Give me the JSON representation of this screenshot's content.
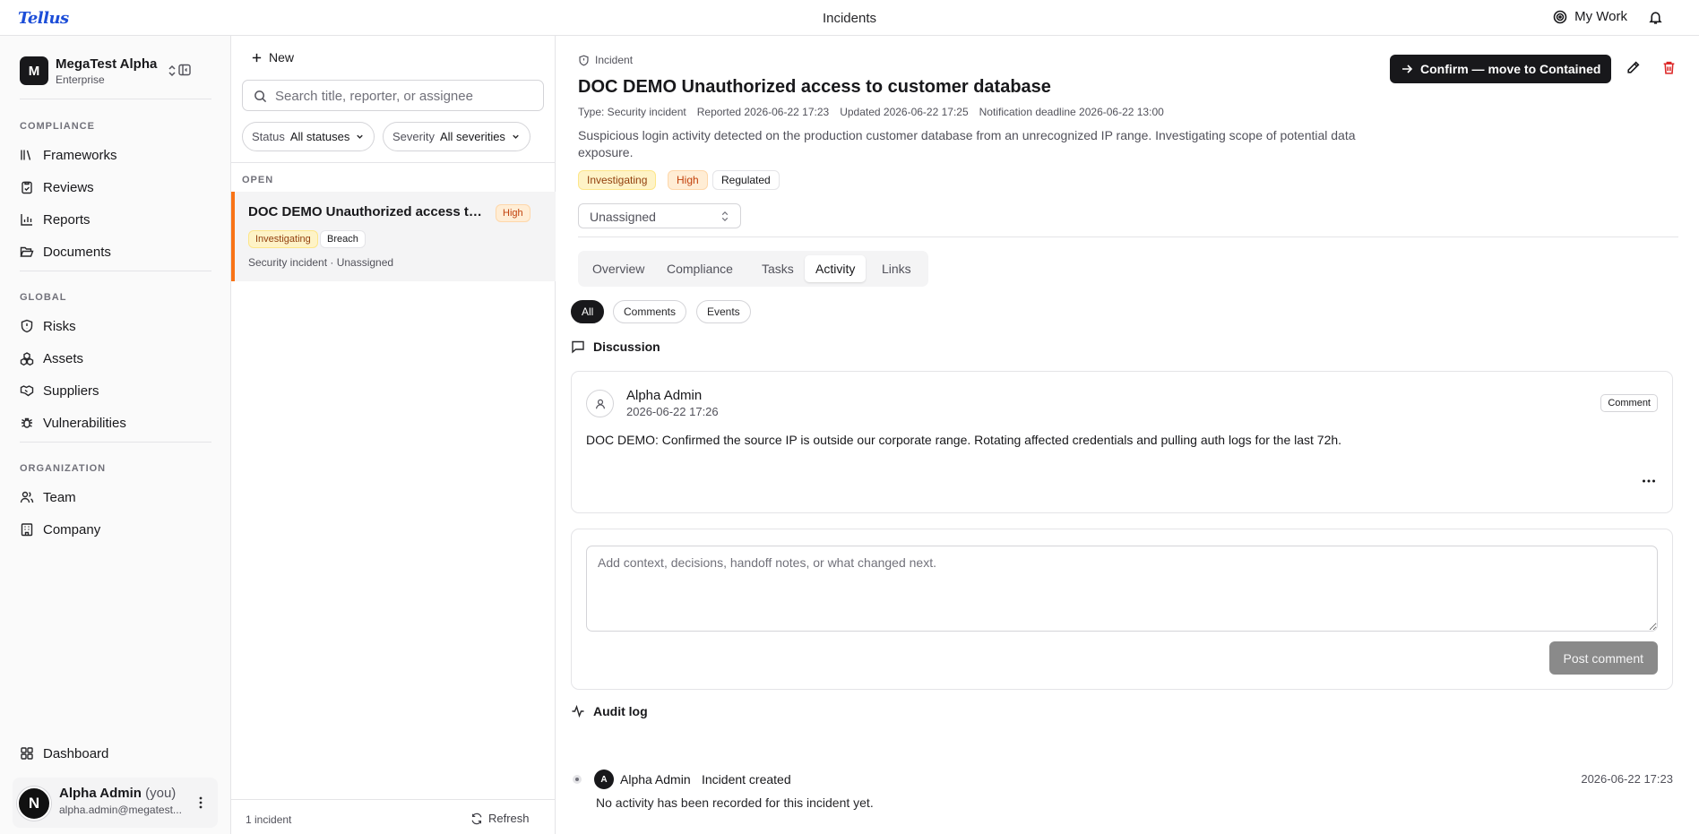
{
  "app": {
    "logo": "Tellus",
    "title": "Incidents",
    "my_work": "My Work"
  },
  "org": {
    "initial": "M",
    "name": "MegaTest Alpha",
    "plan": "Enterprise"
  },
  "nav": {
    "compliance_label": "COMPLIANCE",
    "compliance": [
      "Frameworks",
      "Reviews",
      "Reports",
      "Documents"
    ],
    "global_label": "GLOBAL",
    "global": [
      "Risks",
      "Assets",
      "Suppliers",
      "Vulnerabilities"
    ],
    "organization_label": "ORGANIZATION",
    "organization": [
      "Team",
      "Company"
    ],
    "dashboard": "Dashboard"
  },
  "user": {
    "initial": "N",
    "name": "Alpha Admin",
    "you": "(you)",
    "email": "alpha.admin@megatest..."
  },
  "list": {
    "new_label": "New",
    "search_placeholder": "Search title, reporter, or assignee",
    "status_filter": {
      "label": "Status",
      "value": "All statuses"
    },
    "severity_filter": {
      "label": "Severity",
      "value": "All severities"
    },
    "group_label": "OPEN",
    "items": [
      {
        "title": "DOC DEMO Unauthorized access to customer database",
        "severity": "High",
        "status": "Investigating",
        "tag": "Breach",
        "meta": "Security incident · Unassigned"
      }
    ],
    "count": "1 incident",
    "refresh": "Refresh"
  },
  "detail": {
    "kind": "Incident",
    "title": "DOC DEMO Unauthorized access to customer database",
    "type": "Type: Security incident",
    "reported": "Reported 2026-06-22 17:23",
    "updated": "Updated 2026-06-22 17:25",
    "deadline": "Notification deadline 2026-06-22 13:00",
    "description": "Suspicious login activity detected on the production customer database from an unrecognized IP range. Investigating scope of potential data exposure.",
    "chips": [
      "Investigating",
      "High",
      "Regulated"
    ],
    "confirm_label": "Confirm — move to Contained",
    "assignee": "Unassigned",
    "tabs": [
      "Overview",
      "Compliance",
      "Tasks",
      "Activity",
      "Links"
    ],
    "active_tab": "Activity",
    "filters": [
      "All",
      "Comments",
      "Events"
    ],
    "discussion_label": "Discussion",
    "comment": {
      "author": "Alpha Admin",
      "time": "2026-06-22 17:26",
      "badge": "Comment",
      "text": "DOC DEMO: Confirmed the source IP is outside our corporate range. Rotating affected credentials and pulling auth logs for the last 72h."
    },
    "composer_placeholder": "Add context, decisions, handoff notes, or what changed next.",
    "post_label": "Post comment",
    "audit_label": "Audit log",
    "audit": {
      "initial": "A",
      "actor": "Alpha Admin",
      "event": "Incident created",
      "time": "2026-06-22 17:23",
      "empty": "No activity has been recorded for this incident yet."
    }
  },
  "colors": {
    "accent": "#f97316",
    "brand": "#1d4ed8",
    "danger": "#dc2626",
    "primary": "#18181b"
  }
}
